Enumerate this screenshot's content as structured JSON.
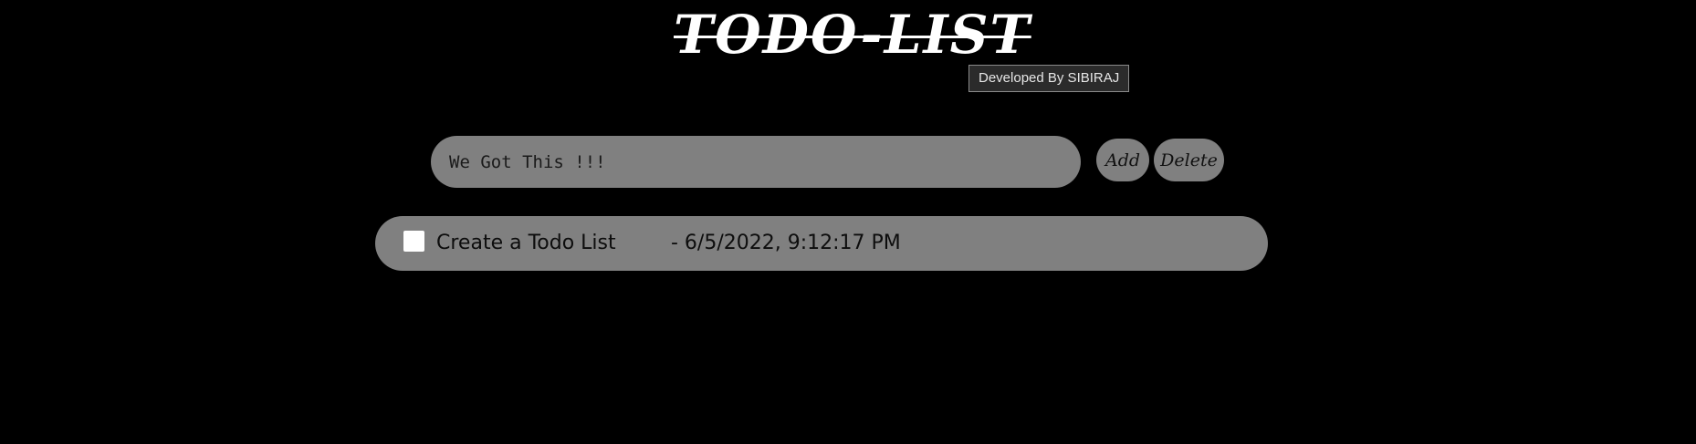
{
  "header": {
    "title": "TODO-LIST",
    "tooltip": "Developed By SIBIRAJ"
  },
  "input": {
    "placeholder": "We Got This !!!",
    "value": ""
  },
  "buttons": {
    "add_label": "Add",
    "delete_label": "Delete"
  },
  "todos": [
    {
      "checked": false,
      "text": "Create a Todo List",
      "timestamp": "- 6/5/2022, 9:12:17 PM"
    }
  ],
  "colors": {
    "background": "#000000",
    "surface": "#808080",
    "title": "#ffffff",
    "checkbox": "#ffffff"
  }
}
